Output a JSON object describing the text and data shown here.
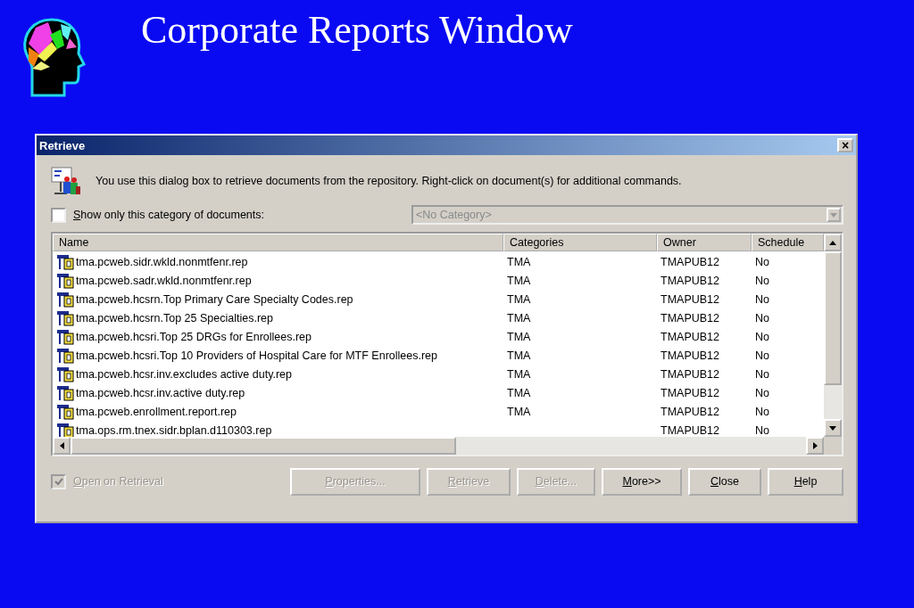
{
  "slide": {
    "title": "Corporate Reports Window"
  },
  "window": {
    "title": "Retrieve",
    "close": "×"
  },
  "info": "You use this dialog box to retrieve documents from the repository. Right-click on document(s) for additional commands.",
  "category_filter": {
    "label": "Show only this category of documents:",
    "mnemonic": true,
    "checked": false,
    "disabled": false
  },
  "category_combo": {
    "value": "<No Category>",
    "disabled": true
  },
  "table": {
    "columns": [
      "Name",
      "Categories",
      "Owner",
      "Schedule"
    ],
    "rows": [
      {
        "name": "tma.pcweb.sidr.wkld.nonmtfenr.rep",
        "categories": "TMA",
        "owner": "TMAPUB12",
        "schedule": "No"
      },
      {
        "name": "tma.pcweb.sadr.wkld.nonmtfenr.rep",
        "categories": "TMA",
        "owner": "TMAPUB12",
        "schedule": "No"
      },
      {
        "name": "tma.pcweb.hcsrn.Top Primary Care Specialty Codes.rep",
        "categories": "TMA",
        "owner": "TMAPUB12",
        "schedule": "No"
      },
      {
        "name": "tma.pcweb.hcsrn.Top 25 Specialties.rep",
        "categories": "TMA",
        "owner": "TMAPUB12",
        "schedule": "No"
      },
      {
        "name": "tma.pcweb.hcsri.Top 25 DRGs for Enrollees.rep",
        "categories": "TMA",
        "owner": "TMAPUB12",
        "schedule": "No"
      },
      {
        "name": "tma.pcweb.hcsri.Top 10 Providers of Hospital Care for MTF Enrollees.rep",
        "categories": "TMA",
        "owner": "TMAPUB12",
        "schedule": "No"
      },
      {
        "name": "tma.pcweb.hcsr.inv.excludes active duty.rep",
        "categories": "TMA",
        "owner": "TMAPUB12",
        "schedule": "No"
      },
      {
        "name": "tma.pcweb.hcsr.inv.active duty.rep",
        "categories": "TMA",
        "owner": "TMAPUB12",
        "schedule": "No"
      },
      {
        "name": "tma.pcweb.enrollment.report.rep",
        "categories": "TMA",
        "owner": "TMAPUB12",
        "schedule": "No"
      },
      {
        "name": "tma.ops.rm.tnex.sidr.bplan.d110303.rep",
        "owner": "TMAPUB12",
        "schedule": "No"
      }
    ]
  },
  "open_on_retrieval": {
    "label": "Open on Retrieval",
    "mnemonic": true,
    "checked": true,
    "disabled": true
  },
  "buttons": [
    {
      "label": "Properties...",
      "mnemonic": true,
      "disabled": true
    },
    {
      "label": "Retrieve",
      "mnemonic": true,
      "disabled": true
    },
    {
      "label": "Delete...",
      "mnemonic": true,
      "disabled": true
    },
    {
      "label": "More>>",
      "mnemonic": true,
      "disabled": false
    },
    {
      "label": "Close",
      "mnemonic": true,
      "disabled": false
    },
    {
      "label": "Help",
      "mnemonic": true,
      "disabled": false
    }
  ]
}
